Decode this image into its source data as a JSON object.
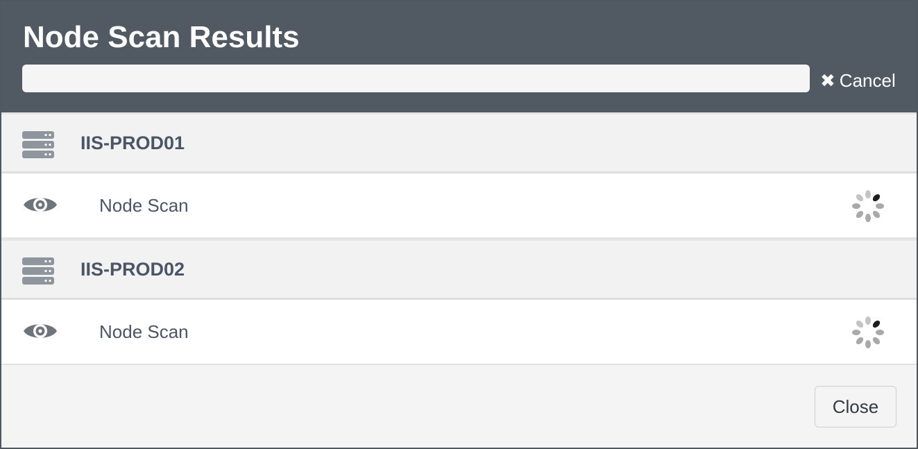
{
  "header": {
    "title": "Node Scan Results",
    "cancel_icon": "✖",
    "cancel_label": "Cancel",
    "progress": 0
  },
  "groups": [
    {
      "name": "IIS-PROD01",
      "icon": "server-icon",
      "items": [
        {
          "label": "Node Scan",
          "icon": "eye-icon",
          "status": "spinner-icon"
        }
      ]
    },
    {
      "name": "IIS-PROD02",
      "icon": "server-icon",
      "items": [
        {
          "label": "Node Scan",
          "icon": "eye-icon",
          "status": "spinner-icon"
        }
      ]
    }
  ],
  "footer": {
    "close_label": "Close"
  },
  "colors": {
    "header_bg": "#515963",
    "group_bg": "#f2f2f2",
    "text": "#4b5566",
    "icon_gray": "#8f959c"
  }
}
